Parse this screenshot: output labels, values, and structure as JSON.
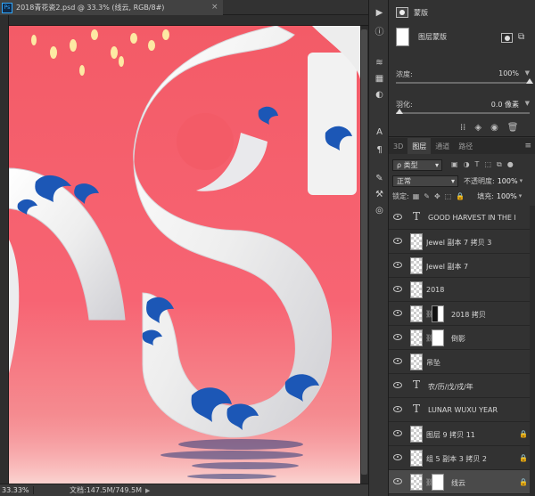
{
  "document": {
    "tab_title": "2018青花瓷2.psd @ 33.3% (线云, RGB/8#)",
    "close_glyph": "×",
    "zoom": "33.33%",
    "info": "文档:147.5M/749.5M"
  },
  "canvas_colors": {
    "bg_top": "#f35b67",
    "bg_bottom": "#f9c4c4",
    "porcelain": "#f3f3f3",
    "blue": "#1c57b6"
  },
  "tools": [
    "play-icon",
    "info-icon",
    "layers-icon",
    "swatches-icon",
    "adjust-icon",
    "text-icon",
    "paragraph-icon",
    "brush-icon",
    "clone-icon",
    "3d-icon"
  ],
  "tool_glyphs": [
    "▶",
    "ⓘ",
    "≋",
    "▦",
    "◐",
    "A",
    "¶",
    "✎",
    "⚒",
    "◎"
  ],
  "properties": {
    "title": "蒙版",
    "mask_label": "图层蒙版",
    "density_label": "浓度:",
    "density_value": "100%",
    "feather_label": "羽化:",
    "feather_value": "0.0 像素",
    "density_level": 1.0,
    "feather_level": 0.0
  },
  "layers_panel": {
    "tabs": [
      "3D",
      "图层",
      "通道",
      "路径"
    ],
    "active_tab": 1,
    "kind_label": "ρ 类型",
    "blend_mode": "正常",
    "opacity_label": "不透明度:",
    "opacity_value": "100%",
    "lock_label": "锁定:",
    "fill_label": "填充:",
    "fill_value": "100%",
    "layers": [
      {
        "name": "GOOD HARVEST IN THE F...",
        "kind": "text",
        "mask": false,
        "locked": false
      },
      {
        "name": "Jewel 副本 7 拷贝 3",
        "kind": "pixel",
        "mask": false,
        "locked": false
      },
      {
        "name": "Jewel 副本 7",
        "kind": "pixel",
        "mask": false,
        "locked": false
      },
      {
        "name": "2018",
        "kind": "pixel",
        "mask": false,
        "locked": false
      },
      {
        "name": "2018 拷贝",
        "kind": "pixel",
        "mask": "dark",
        "locked": false
      },
      {
        "name": "倒影",
        "kind": "pixel",
        "mask": "light",
        "locked": false
      },
      {
        "name": "吊坠",
        "kind": "pixel",
        "mask": false,
        "locked": false
      },
      {
        "name": "农/历/戊/戌/年",
        "kind": "text",
        "mask": false,
        "locked": false
      },
      {
        "name": "LUNAR WUXU YEAR",
        "kind": "text",
        "mask": false,
        "locked": false
      },
      {
        "name": "图层 9 拷贝 11",
        "kind": "pixel",
        "mask": false,
        "locked": true
      },
      {
        "name": "组 5 副本 3 拷贝 2",
        "kind": "pixel",
        "mask": false,
        "locked": true
      },
      {
        "name": "线云",
        "kind": "pixel",
        "mask": "light",
        "locked": true,
        "selected": true
      }
    ]
  }
}
